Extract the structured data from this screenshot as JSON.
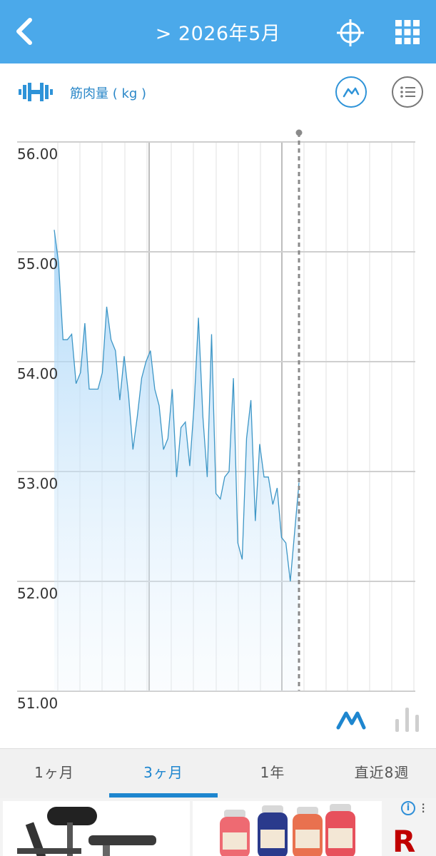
{
  "header": {
    "title": "> 2026年5月",
    "back_icon": "chevron-left-icon",
    "target_icon": "crosshair-icon",
    "grid_icon": "grid-menu-icon",
    "color": "#4ba9ea"
  },
  "subheader": {
    "metric_icon": "dumbbell-icon",
    "metric_label": "筋肉量 ( kg )",
    "line_view_icon": "line-chart-icon",
    "list_view_icon": "list-icon"
  },
  "chart_data": {
    "type": "area",
    "title": "",
    "xlabel": "",
    "ylabel": "筋肉量 ( kg )",
    "ylim": [
      51.0,
      56.0
    ],
    "yticks": [
      "56.00",
      "55.00",
      "54.00",
      "53.00",
      "52.00",
      "51.00"
    ],
    "grid": true,
    "series": [
      {
        "values": [
          55.2,
          54.9,
          54.2,
          54.2,
          54.25,
          53.8,
          53.9,
          54.35,
          53.75,
          53.75,
          53.75,
          53.9,
          54.5,
          54.2,
          54.1,
          53.65,
          54.05,
          53.7,
          53.2,
          53.5,
          53.85,
          54.0,
          54.1,
          53.75,
          53.6,
          53.2,
          53.3,
          53.75,
          52.95,
          53.4,
          53.45,
          53.05,
          53.6,
          54.4,
          53.5,
          52.95,
          54.25,
          52.8,
          52.75,
          52.95,
          53.0,
          53.85,
          52.35,
          52.2,
          53.3,
          53.65,
          52.55,
          53.25,
          52.95,
          52.95,
          52.7,
          52.85,
          52.4,
          52.35,
          52.0,
          52.45,
          52.9
        ]
      }
    ],
    "line_color": "#3d96c6",
    "fill_color": "#bcdffa"
  },
  "chart_toggles": {
    "line_icon": "line-chart-icon",
    "bar_icon": "bar-chart-icon"
  },
  "tabs": [
    {
      "label": "1ヶ月",
      "active": false
    },
    {
      "label": "3ヶ月",
      "active": true
    },
    {
      "label": "1年",
      "active": false
    },
    {
      "label": "直近8週",
      "active": false
    }
  ],
  "ad": {
    "info_label": "i",
    "close_label": "⁝",
    "brand_letter": "R"
  }
}
